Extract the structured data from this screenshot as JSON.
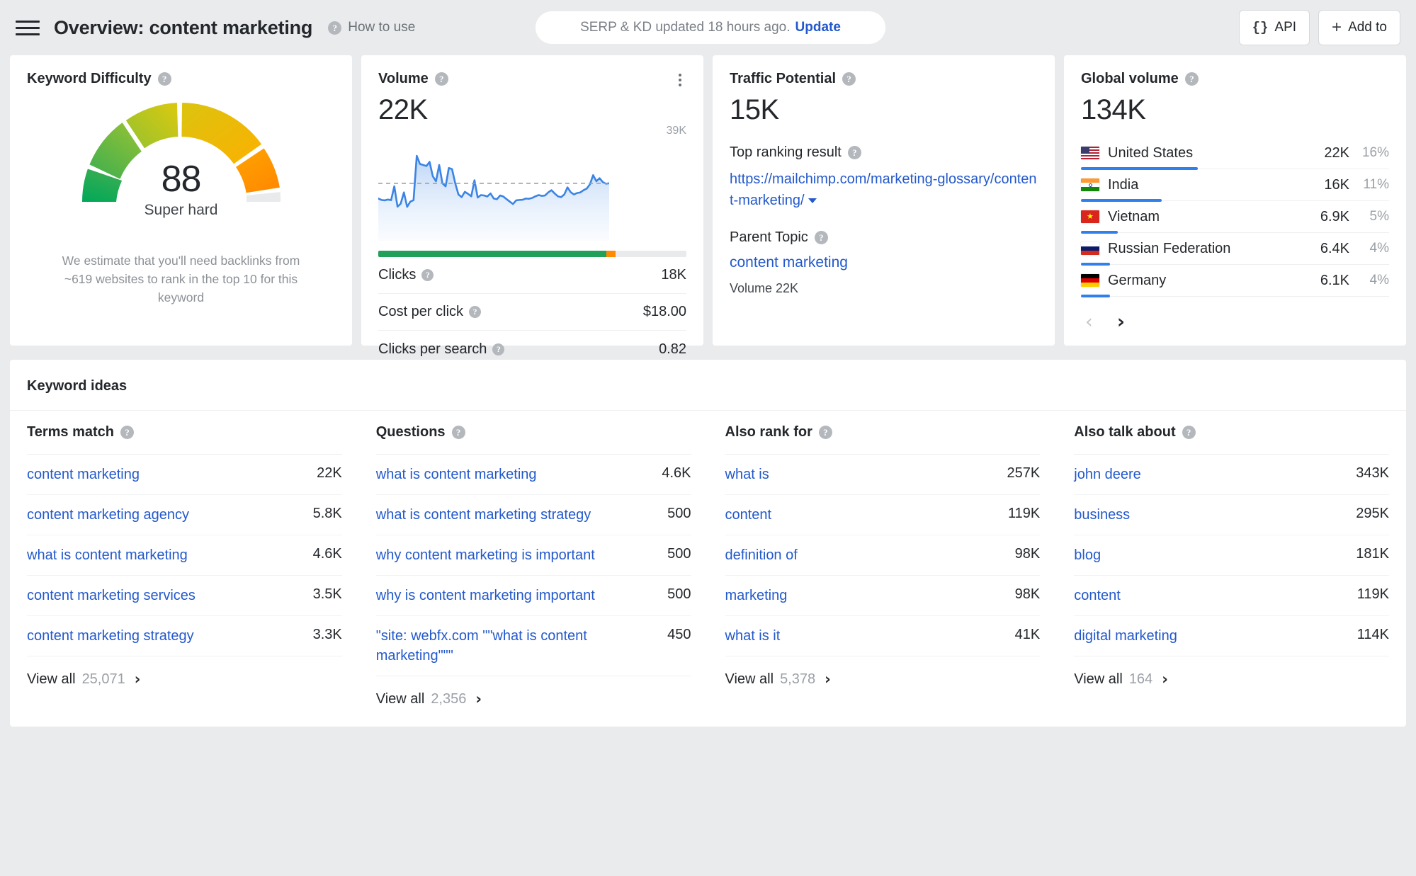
{
  "header": {
    "menu_icon": "hamburger-icon",
    "title": "Overview: content marketing",
    "how_to_use": "How to use",
    "update_pill_text": "SERP & KD updated 18 hours ago.",
    "update_link": "Update",
    "api_button": "API",
    "add_to_button": "Add to"
  },
  "keyword_difficulty": {
    "title": "Keyword Difficulty",
    "value": "88",
    "label": "Super hard",
    "note": "We estimate that you'll need backlinks from ~619 websites to rank in the top 10 for this keyword"
  },
  "volume": {
    "title": "Volume",
    "value": "22K",
    "chart_max_label": "39K",
    "rows": [
      {
        "label": "Clicks",
        "value": "18K"
      },
      {
        "label": "Cost per click",
        "value": "$18.00"
      },
      {
        "label": "Clicks per search",
        "value": "0.82"
      }
    ],
    "clicks_bar": {
      "green_pct": 74,
      "orange_pct": 3,
      "grey_pct": 23
    }
  },
  "traffic_potential": {
    "title": "Traffic Potential",
    "value": "15K",
    "top_ranking_result_label": "Top ranking result",
    "top_ranking_result_url": "https://mailchimp.com/marketing-glossary/content-marketing/",
    "parent_topic_label": "Parent Topic",
    "parent_topic": "content marketing",
    "parent_topic_volume": "Volume 22K"
  },
  "global_volume": {
    "title": "Global volume",
    "value": "134K",
    "countries": [
      {
        "name": "United States",
        "volume": "22K",
        "pct": "16%",
        "bar": 16,
        "flag": "us-flag-icon"
      },
      {
        "name": "India",
        "volume": "16K",
        "pct": "11%",
        "bar": 11,
        "flag": "in-flag-icon"
      },
      {
        "name": "Vietnam",
        "volume": "6.9K",
        "pct": "5%",
        "bar": 5,
        "flag": "vn-flag-icon"
      },
      {
        "name": "Russian Federation",
        "volume": "6.4K",
        "pct": "4%",
        "bar": 4,
        "flag": "ru-flag-icon"
      },
      {
        "name": "Germany",
        "volume": "6.1K",
        "pct": "4%",
        "bar": 4,
        "flag": "de-flag-icon"
      }
    ],
    "prev_label": "‹",
    "next_label": "›"
  },
  "keyword_ideas": {
    "title": "Keyword ideas",
    "view_all_label": "View all",
    "columns": [
      {
        "header": "Terms match",
        "rows": [
          {
            "term": "content marketing",
            "value": "22K"
          },
          {
            "term": "content marketing agency",
            "value": "5.8K"
          },
          {
            "term": "what is content marketing",
            "value": "4.6K"
          },
          {
            "term": "content marketing services",
            "value": "3.5K"
          },
          {
            "term": "content marketing strategy",
            "value": "3.3K"
          }
        ],
        "view_all_count": "25,071"
      },
      {
        "header": "Questions",
        "rows": [
          {
            "term": "what is content marketing",
            "value": "4.6K"
          },
          {
            "term": "what is content marketing strategy",
            "value": "500"
          },
          {
            "term": "why content marketing is important",
            "value": "500"
          },
          {
            "term": "why is content marketing important",
            "value": "500"
          },
          {
            "term": "\"site: webfx.com \"\"what is content marketing\"\"\"",
            "value": "450"
          }
        ],
        "view_all_count": "2,356"
      },
      {
        "header": "Also rank for",
        "rows": [
          {
            "term": "what is",
            "value": "257K"
          },
          {
            "term": "content",
            "value": "119K"
          },
          {
            "term": "definition of",
            "value": "98K"
          },
          {
            "term": "marketing",
            "value": "98K"
          },
          {
            "term": "what is it",
            "value": "41K"
          }
        ],
        "view_all_count": "5,378"
      },
      {
        "header": "Also talk about",
        "rows": [
          {
            "term": "john deere",
            "value": "343K"
          },
          {
            "term": "business",
            "value": "295K"
          },
          {
            "term": "blog",
            "value": "181K"
          },
          {
            "term": "content",
            "value": "119K"
          },
          {
            "term": "digital marketing",
            "value": "114K"
          }
        ],
        "view_all_count": "164"
      }
    ]
  },
  "colors": {
    "link": "#2359cc",
    "accent_blue": "#2f80ed",
    "green": "#21a05a",
    "orange": "#ff8a00",
    "page_bg": "#eaebed",
    "text": "#24272b",
    "muted": "#9aa0a6"
  },
  "chart_data": {
    "type": "area",
    "title": "Volume trend",
    "ylabel": "",
    "xlabel": "",
    "ymax_label": "39K",
    "ylim": [
      0,
      39000
    ],
    "grid": false,
    "legend": null,
    "average_line": 22000,
    "values": [
      14500,
      13800,
      13600,
      14000,
      13700,
      20500,
      10500,
      12000,
      17500,
      10400,
      13000,
      13700,
      35500,
      31500,
      31000,
      30500,
      32500,
      25500,
      23000,
      31000,
      22000,
      20500,
      29500,
      29000,
      22000,
      16500,
      15200,
      17800,
      16800,
      15600,
      23500,
      15000,
      16200,
      16000,
      15500,
      17000,
      14500,
      14200,
      16000,
      15500,
      14200,
      13000,
      11800,
      13600,
      13800,
      13900,
      14500,
      14400,
      14800,
      15600,
      16200,
      15800,
      16000,
      17500,
      18600,
      17000,
      15600,
      15200,
      16500,
      20000,
      17600,
      16500,
      17200,
      17500,
      18600,
      19400,
      21500,
      26000,
      23000,
      24500,
      22600,
      21800,
      22000
    ]
  }
}
